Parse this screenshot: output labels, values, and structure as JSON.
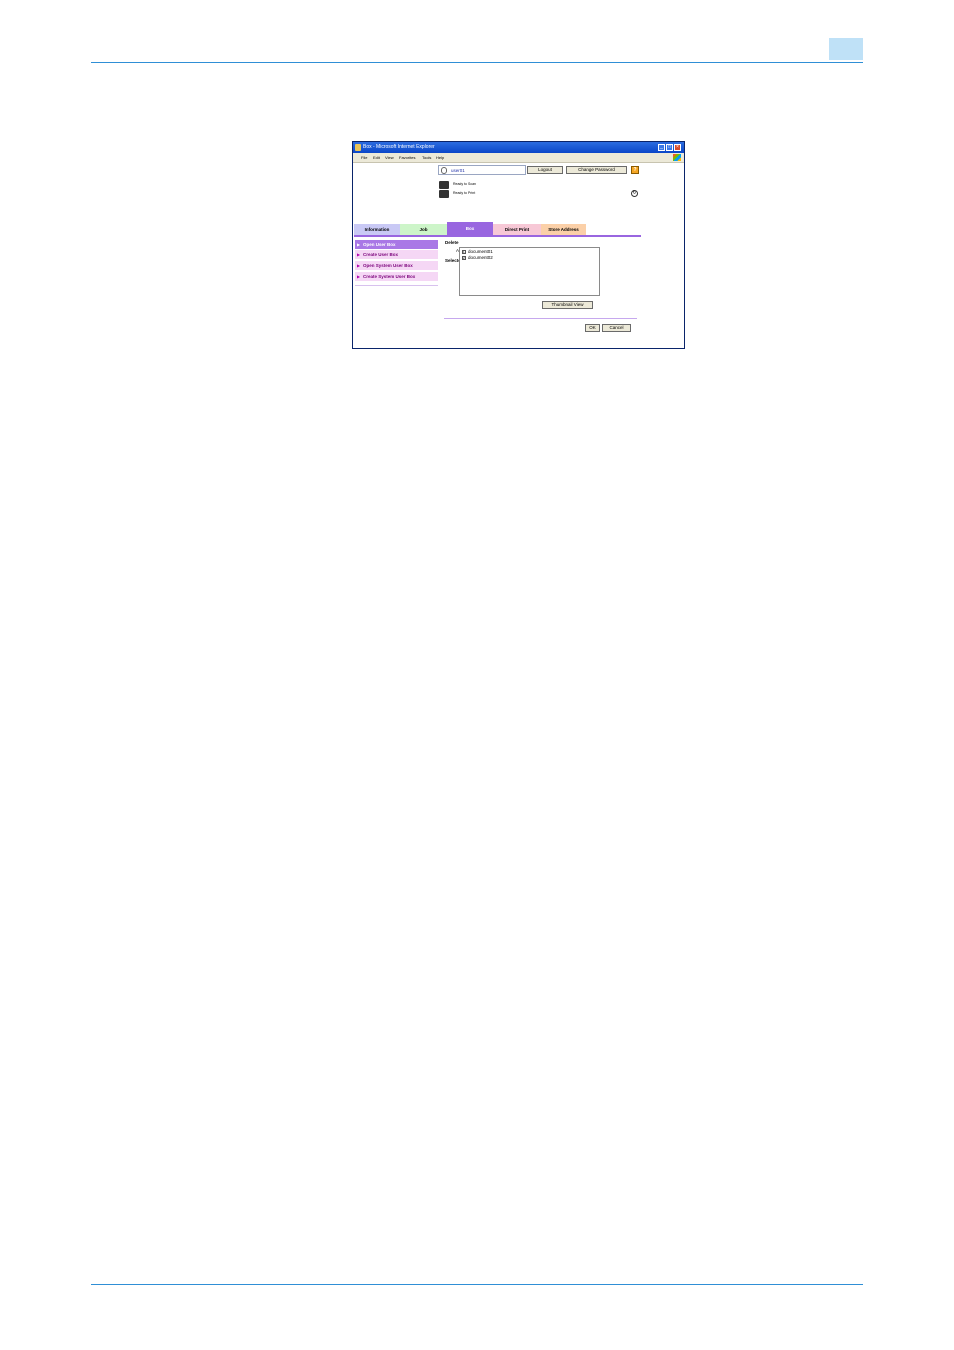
{
  "browser": {
    "title": "Box - Microsoft Internet Explorer",
    "min_glyph": "_",
    "max_glyph": "□",
    "close_glyph": "×",
    "menus": [
      "File",
      "Edit",
      "View",
      "Favorites",
      "Tools",
      "Help"
    ]
  },
  "header": {
    "user_name": "user01",
    "logout_label": "Logout",
    "change_password_label": "Change Password",
    "help_glyph": "?",
    "scanner_status": "Ready to Scan",
    "printer_status": "Ready to Print",
    "refresh_glyph": "↻"
  },
  "tabs": [
    {
      "label": "Information",
      "color": "#c9c9f5"
    },
    {
      "label": "Job",
      "color": "#cdf5c9"
    },
    {
      "label": "Box",
      "color": "#9966e0"
    },
    {
      "label": "Direct Print",
      "color": "#f7c8d6"
    },
    {
      "label": "Store Address",
      "color": "#fbd0a8"
    }
  ],
  "sidebar": {
    "items": [
      {
        "label": "Open User Box"
      },
      {
        "label": "Create User Box"
      },
      {
        "label": "Open System User Box"
      },
      {
        "label": "Create System User Box"
      }
    ],
    "arrow_glyph": "▶"
  },
  "main": {
    "heading": "Delete",
    "question": "Are you sure you want to delete?",
    "selected_label": "Selected File",
    "files": [
      {
        "index": "1",
        "name": "document01"
      },
      {
        "index": "2",
        "name": "document02"
      }
    ],
    "thumbnail_label": "Thumbnail View",
    "ok_label": "OK",
    "cancel_label": "Cancel"
  }
}
